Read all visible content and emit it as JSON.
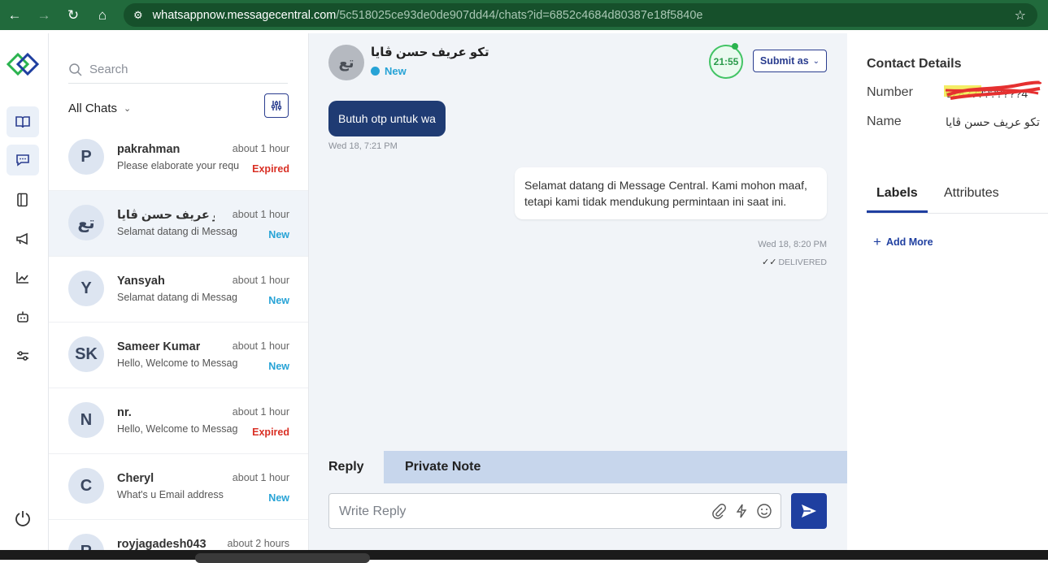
{
  "browser": {
    "url_host": "whatsappnow.messagecentral.com",
    "url_path": "/5c518025ce93de0de907dd44/chats?id=6852c4684d80387e18f5840e"
  },
  "chatlist": {
    "search_placeholder": "Search",
    "filter_label": "All Chats",
    "chats": [
      {
        "initials": "P",
        "name": "pakrahman",
        "time": "about 1 hour",
        "preview": "Please elaborate your requ",
        "status": "Expired"
      },
      {
        "initials": "تع",
        "name": "تكو عريف حسن ڤايا",
        "time": "about 1 hour",
        "preview": "Selamat datang di Messag",
        "status": "New"
      },
      {
        "initials": "Y",
        "name": "Yansyah",
        "time": "about 1 hour",
        "preview": "Selamat datang di Messag",
        "status": "New"
      },
      {
        "initials": "SK",
        "name": "Sameer Kumar",
        "time": "about 1 hour",
        "preview": "Hello, Welcome to Messag",
        "status": "New"
      },
      {
        "initials": "N",
        "name": "nr.",
        "time": "about 1 hour",
        "preview": "Hello, Welcome to Messag",
        "status": "Expired"
      },
      {
        "initials": "C",
        "name": "Cheryl",
        "time": "about 1 hour",
        "preview": "What's u Email address",
        "status": "New"
      },
      {
        "initials": "R",
        "name": "royjagadesh043",
        "time": "about 2 hours",
        "preview": "",
        "status": ""
      }
    ]
  },
  "conversation": {
    "avatar_initials": "تع",
    "name": "تكو عريف حسن ڤايا",
    "status": "New",
    "timer": "21:55",
    "submit_label": "Submit as",
    "incoming_message": "Butuh otp untuk wa",
    "incoming_time": "Wed 18, 7:21 PM",
    "outgoing_message": "Selamat datang di Message Central. Kami mohon maaf, tetapi kami tidak mendukung permintaan ini saat ini.",
    "outgoing_time": "Wed 18, 8:20 PM",
    "delivery_status": "DELIVERED",
    "tab_reply": "Reply",
    "tab_note": "Private Note",
    "reply_placeholder": "Write Reply"
  },
  "details": {
    "title": "Contact Details",
    "number_label": "Number",
    "number_value": "628?????????4",
    "name_label": "Name",
    "name_value": "تكو عريف حسن ڤايا",
    "tab_labels": "Labels",
    "tab_attributes": "Attributes",
    "add_more": "Add More"
  },
  "colors": {
    "browser_green": "#216a3c",
    "brand_blue": "#1f3fa0",
    "incoming_bubble": "#1f3b73",
    "status_new": "#27a3d6",
    "status_expired": "#d93025",
    "timer_green": "#43c465"
  }
}
